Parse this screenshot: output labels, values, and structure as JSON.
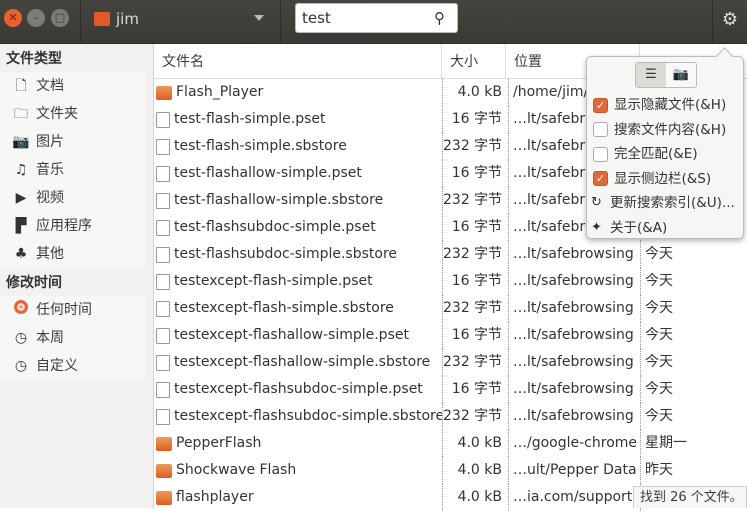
{
  "window": {
    "controls": [
      "close",
      "minimize",
      "maximize"
    ]
  },
  "toolbar": {
    "folder": "jim",
    "search_value": "test",
    "search_icon": "search-icon",
    "menu_icon": "gear-icon"
  },
  "sidebar": {
    "file_type_title": "文件类型",
    "file_types": [
      {
        "label": "文档",
        "icon": "document-icon"
      },
      {
        "label": "文件夹",
        "icon": "folder-icon"
      },
      {
        "label": "图片",
        "icon": "camera-icon"
      },
      {
        "label": "音乐",
        "icon": "music-icon"
      },
      {
        "label": "视频",
        "icon": "video-icon"
      },
      {
        "label": "应用程序",
        "icon": "application-icon"
      },
      {
        "label": "其他",
        "icon": "other-icon"
      }
    ],
    "modified_title": "修改时间",
    "modified": [
      {
        "label": "任何时间",
        "selected": true
      },
      {
        "label": "本周",
        "selected": false
      },
      {
        "label": "自定义",
        "selected": false
      }
    ]
  },
  "table": {
    "columns": [
      "文件名",
      "大小",
      "位置",
      ""
    ],
    "rows": [
      {
        "name": "Flash_Player",
        "type": "folder",
        "size": "4.0 kB",
        "location": "/home/jim/",
        "modified": ""
      },
      {
        "name": "test-flash-simple.pset",
        "type": "file",
        "size": "16 字节",
        "location": "…lt/safebr",
        "modified": ""
      },
      {
        "name": "test-flash-simple.sbstore",
        "type": "file",
        "size": "232 字节",
        "location": "…lt/safebr",
        "modified": ""
      },
      {
        "name": "test-flashallow-simple.pset",
        "type": "file",
        "size": "16 字节",
        "location": "…lt/safebr",
        "modified": ""
      },
      {
        "name": "test-flashallow-simple.sbstore",
        "type": "file",
        "size": "232 字节",
        "location": "…lt/safebr",
        "modified": ""
      },
      {
        "name": "test-flashsubdoc-simple.pset",
        "type": "file",
        "size": "16 字节",
        "location": "…lt/safebr",
        "modified": ""
      },
      {
        "name": "test-flashsubdoc-simple.sbstore",
        "type": "file",
        "size": "232 字节",
        "location": "…lt/safebrowsing",
        "modified": "今天"
      },
      {
        "name": "testexcept-flash-simple.pset",
        "type": "file",
        "size": "16 字节",
        "location": "…lt/safebrowsing",
        "modified": "今天"
      },
      {
        "name": "testexcept-flash-simple.sbstore",
        "type": "file",
        "size": "232 字节",
        "location": "…lt/safebrowsing",
        "modified": "今天"
      },
      {
        "name": "testexcept-flashallow-simple.pset",
        "type": "file",
        "size": "16 字节",
        "location": "…lt/safebrowsing",
        "modified": "今天"
      },
      {
        "name": "testexcept-flashallow-simple.sbstore",
        "type": "file",
        "size": "232 字节",
        "location": "…lt/safebrowsing",
        "modified": "今天"
      },
      {
        "name": "testexcept-flashsubdoc-simple.pset",
        "type": "file",
        "size": "16 字节",
        "location": "…lt/safebrowsing",
        "modified": "今天"
      },
      {
        "name": "testexcept-flashsubdoc-simple.sbstore",
        "type": "file",
        "size": "232 字节",
        "location": "…lt/safebrowsing",
        "modified": "今天"
      },
      {
        "name": "PepperFlash",
        "type": "folder",
        "size": "4.0 kB",
        "location": "…/google-chrome",
        "modified": "星期一"
      },
      {
        "name": "Shockwave Flash",
        "type": "folder",
        "size": "4.0 kB",
        "location": "…ult/Pepper Data",
        "modified": "昨天"
      },
      {
        "name": "flashplayer",
        "type": "folder",
        "size": "4.0 kB",
        "location": "…ia.com/support",
        "modified": ""
      }
    ]
  },
  "popover": {
    "view_icons": [
      "list-icon",
      "camera-icon"
    ],
    "items": [
      {
        "label": "显示隐藏文件(&H)",
        "type": "check",
        "checked": true
      },
      {
        "label": "搜索文件内容(&H)",
        "type": "check",
        "checked": false
      },
      {
        "label": "完全匹配(&E)",
        "type": "check",
        "checked": false
      },
      {
        "label": "显示侧边栏(&S)",
        "type": "check",
        "checked": true
      },
      {
        "label": "更新搜索索引(&U)...",
        "type": "action",
        "icon": "refresh-icon"
      },
      {
        "label": "关于(&A)",
        "type": "action",
        "icon": "star-icon"
      }
    ]
  },
  "status": "找到 26 个文件。",
  "colors": {
    "accent": "#e0683a",
    "titlebar": "#3c3b37"
  }
}
